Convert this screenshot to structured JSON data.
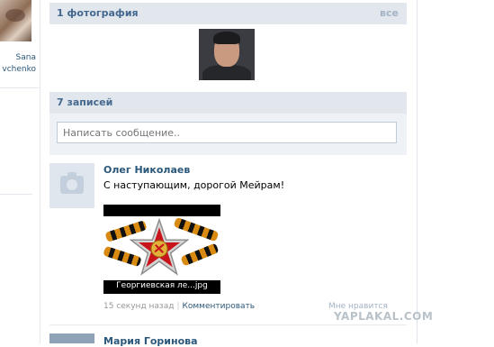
{
  "sidebar": {
    "friend_name_line1": "Sana",
    "friend_name_line2": "vchenko"
  },
  "photos_section": {
    "title": "1 фотография",
    "all_link": "все"
  },
  "posts_section": {
    "title": "7 записей",
    "compose_placeholder": "Написать сообщение.."
  },
  "posts": [
    {
      "author": "Олег Николаев",
      "text": "С наступающим, дорогой Мейрам!",
      "attachment_caption": "Георгиевская ле...jpg",
      "time": "15 секунд назад",
      "separator": "|",
      "comment_link": "Комментировать",
      "like_link": "Мне нравится"
    },
    {
      "author": "Мария Горинова"
    }
  ],
  "watermark": "YAPLAKAL.COM",
  "colors": {
    "section_header_bg": "#e1e7ed",
    "link_blue": "#2b587a",
    "header_text": "#45688e"
  }
}
